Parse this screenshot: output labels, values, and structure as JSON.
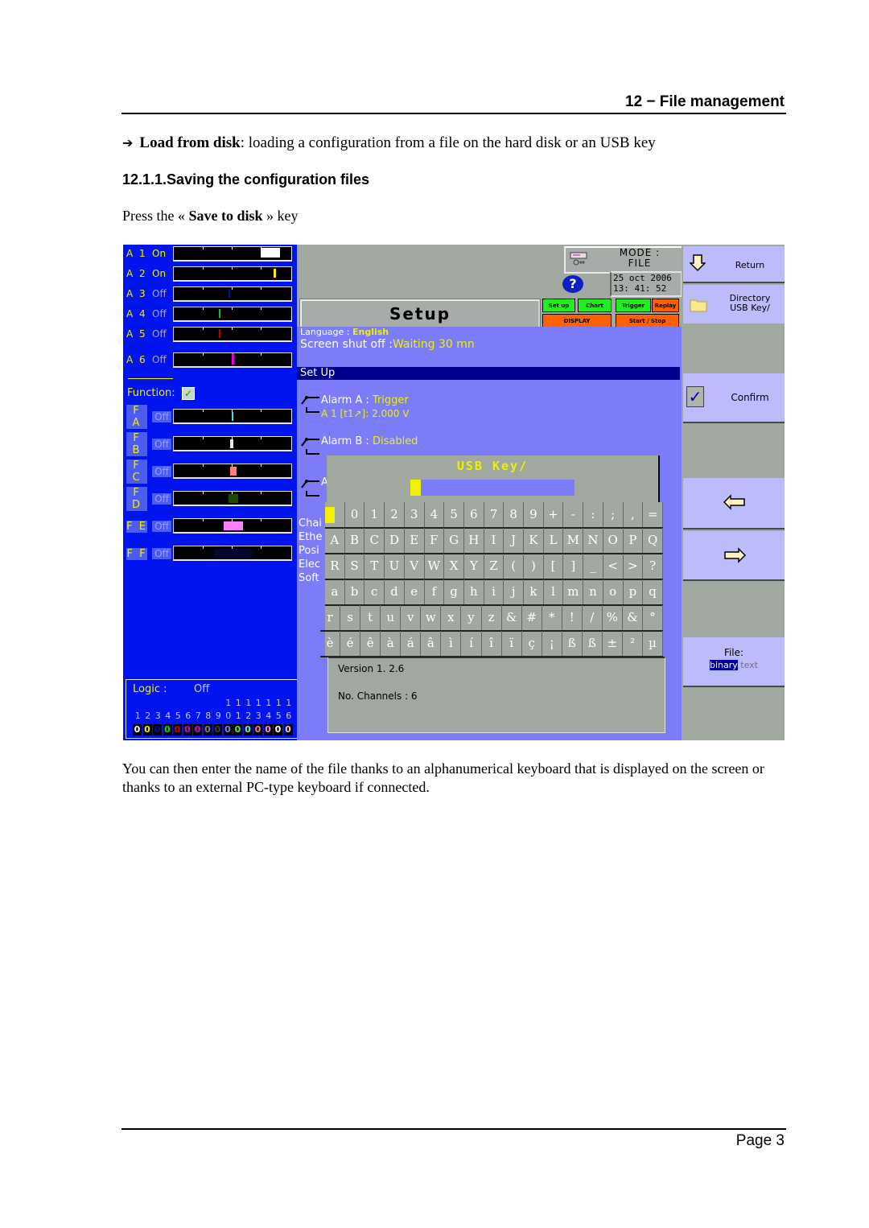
{
  "header": {
    "chapter_title": "12 − File management"
  },
  "bullet": {
    "arrow_icon": "➔",
    "bold": "Load from disk",
    "rest": ": loading a configuration from a file on the hard disk or an USB key"
  },
  "section": {
    "title": "12.1.1.Saving the configuration files"
  },
  "instruction": {
    "prefix": "Press the « ",
    "key_name": "Save to disk",
    "suffix": " » key"
  },
  "device": {
    "analog_channels": [
      {
        "name": "A 1",
        "state": "On",
        "color": "#ffffff"
      },
      {
        "name": "A 2",
        "state": "On",
        "color": "#f0f000"
      },
      {
        "name": "A 3",
        "state": "Off",
        "color": "#0010a0"
      },
      {
        "name": "A 4",
        "state": "Off",
        "color": "#10c010"
      },
      {
        "name": "A 5",
        "state": "Off",
        "color": "#c00000"
      },
      {
        "name": "A 6",
        "state": "Off",
        "color": "#e000e0"
      }
    ],
    "function_label": "Function:",
    "function_check_icon": "✓",
    "function_channels": [
      {
        "name": "F A",
        "state": "Off",
        "color": "#40e0e0"
      },
      {
        "name": "F B",
        "state": "Off",
        "color": "#f0e8f8"
      },
      {
        "name": "F C",
        "state": "Off",
        "color": "#ff8080"
      },
      {
        "name": "F D",
        "state": "Off",
        "color": "#204800"
      },
      {
        "name": "F E",
        "state": "Off",
        "color": "#ff80ff"
      },
      {
        "name": "F F",
        "state": "Off",
        "color": "#000830"
      }
    ],
    "logic": {
      "label": "Logic :",
      "state": "Off",
      "tens": [
        "",
        "",
        "",
        "",
        "",
        "",
        "",
        "",
        "",
        "1",
        "1",
        "1",
        "1",
        "1",
        "1",
        "1"
      ],
      "units": [
        "1",
        "2",
        "3",
        "4",
        "5",
        "6",
        "7",
        "8",
        "9",
        "0",
        "1",
        "2",
        "3",
        "4",
        "5",
        "6"
      ],
      "bits": [
        {
          "value": "0",
          "color": "#ffffff"
        },
        {
          "value": "0",
          "color": "#f0f000"
        },
        {
          "value": "0",
          "color": "#0010a0"
        },
        {
          "value": "0",
          "color": "#10e010"
        },
        {
          "value": "0",
          "color": "#e00000"
        },
        {
          "value": "0",
          "color": "#e000e0"
        },
        {
          "value": "0",
          "color": "#e000e0"
        },
        {
          "value": "0",
          "color": "#808080"
        },
        {
          "value": "0",
          "color": "#404040"
        },
        {
          "value": "0",
          "color": "#8080ff"
        },
        {
          "value": "0",
          "color": "#60e060"
        },
        {
          "value": "0",
          "color": "#60f0f0"
        },
        {
          "value": "0",
          "color": "#ff8080"
        },
        {
          "value": "0",
          "color": "#ff80ff"
        },
        {
          "value": "0",
          "color": "#ffffff"
        },
        {
          "value": "0",
          "color": "#f0c0f0"
        }
      ]
    },
    "mode": {
      "icon": "printer-plug-icon",
      "line1": "MODE :",
      "line2": "FILE"
    },
    "help_icon": "?",
    "date": "25 oct 2006",
    "time": "13: 41: 52",
    "screen_title": "Setup",
    "top_buttons": {
      "setup": "Set up",
      "chart": "Chart",
      "trigger": "Trigger",
      "replay": "Replay",
      "display": "DISPLAY",
      "start_stop": "Start / Stop"
    },
    "language_label": "Language : ",
    "language_value": "English",
    "shutoff_label": "Screen shut off :",
    "shutoff_value": "Waiting  30 mn",
    "setup_bar": "Set Up",
    "alarm_a_label": "Alarm A : ",
    "alarm_a_value": "Trigger",
    "alarm_a_detail": "A 1 [t1↗]:  2.000 V",
    "alarm_b_label": "Alarm B :  ",
    "alarm_b_value": "Disabled",
    "alarm_c_partial": "A",
    "side_labels": [
      "Chai",
      "Ethe",
      "Posi",
      "Elec",
      "Soft"
    ],
    "dialog_title": "USB Key/",
    "dialog_input_value": "",
    "keyboard_rows": [
      [
        "▌",
        "0",
        "1",
        "2",
        "3",
        "4",
        "5",
        "6",
        "7",
        "8",
        "9",
        "+",
        "-",
        ":",
        ";",
        ",",
        "="
      ],
      [
        "A",
        "B",
        "C",
        "D",
        "E",
        "F",
        "G",
        "H",
        "I",
        "J",
        "K",
        "L",
        "M",
        "N",
        "O",
        "P",
        "Q"
      ],
      [
        "R",
        "S",
        "T",
        "U",
        "V",
        "W",
        "X",
        "Y",
        "Z",
        "(",
        ")",
        "[",
        "]",
        "_",
        "<",
        ">",
        "?"
      ],
      [
        "a",
        "b",
        "c",
        "d",
        "e",
        "f",
        "g",
        "h",
        "i",
        "j",
        "k",
        "l",
        "m",
        "n",
        "o",
        "p",
        "q"
      ],
      [
        "r",
        "s",
        "t",
        "u",
        "v",
        "w",
        "x",
        "y",
        "z",
        "&",
        "#",
        "*",
        "!",
        "/",
        "%",
        "&",
        "°"
      ],
      [
        "è",
        "é",
        "ê",
        "à",
        "á",
        "â",
        "ì",
        "í",
        "î",
        "ï",
        "ç",
        "¡",
        "ß",
        "ß",
        "±",
        "²",
        "µ"
      ]
    ],
    "version": "Version 1. 2.6",
    "channels": "No. Channels : 6",
    "right_buttons": {
      "return_label": "Return",
      "return_icon": "⇩",
      "directory_label_1": "Directory",
      "directory_label_2": "USB Key/",
      "confirm_label": "Confirm",
      "confirm_icon": "✓",
      "left_arrow_icon": "⇦",
      "right_arrow_icon": "⇨",
      "file_label": "File:",
      "file_selected": "binary",
      "file_unselected": "text"
    }
  },
  "paragraph": "You can then enter the name of the file thanks to an alphanumerical keyboard that is displayed on the screen or thanks to an external PC-type keyboard if connected.",
  "footer": {
    "page": "Page 3"
  }
}
